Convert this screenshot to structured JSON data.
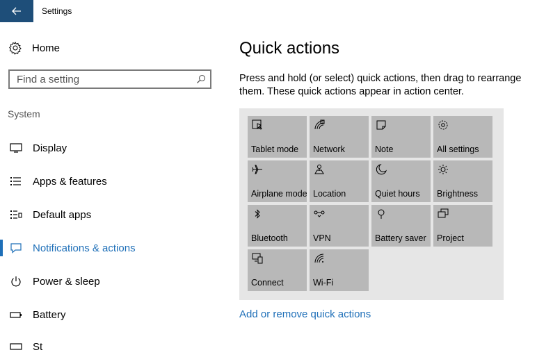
{
  "window": {
    "title": "Settings"
  },
  "sidebar": {
    "home_label": "Home",
    "search_placeholder": "Find a setting",
    "section_label": "System",
    "items": [
      {
        "label": "Display",
        "icon": "display-icon",
        "active": false
      },
      {
        "label": "Apps & features",
        "icon": "list-icon",
        "active": false
      },
      {
        "label": "Default apps",
        "icon": "default-apps-icon",
        "active": false
      },
      {
        "label": "Notifications & actions",
        "icon": "notification-icon",
        "active": true
      },
      {
        "label": "Power & sleep",
        "icon": "power-icon",
        "active": false
      },
      {
        "label": "Battery",
        "icon": "battery-icon",
        "active": false
      },
      {
        "label": "St",
        "icon": "storage-icon",
        "active": false
      }
    ]
  },
  "main": {
    "title": "Quick actions",
    "description": "Press and hold (or select) quick actions, then drag to rearrange them. These quick actions appear in action center.",
    "tiles": [
      {
        "label": "Tablet mode",
        "icon": "tablet-mode-icon"
      },
      {
        "label": "Network",
        "icon": "network-icon"
      },
      {
        "label": "Note",
        "icon": "note-icon"
      },
      {
        "label": "All settings",
        "icon": "gear-icon"
      },
      {
        "label": "Airplane mode",
        "icon": "airplane-icon"
      },
      {
        "label": "Location",
        "icon": "location-icon"
      },
      {
        "label": "Quiet hours",
        "icon": "moon-icon"
      },
      {
        "label": "Brightness",
        "icon": "sun-icon"
      },
      {
        "label": "Bluetooth",
        "icon": "bluetooth-icon"
      },
      {
        "label": "VPN",
        "icon": "vpn-icon"
      },
      {
        "label": "Battery saver",
        "icon": "battery-saver-icon"
      },
      {
        "label": "Project",
        "icon": "project-icon"
      },
      {
        "label": "Connect",
        "icon": "connect-icon"
      },
      {
        "label": "Wi-Fi",
        "icon": "wifi-icon"
      }
    ],
    "link_label": "Add or remove quick actions"
  },
  "colors": {
    "accent": "#1e6fb8",
    "titlebar_back": "#1e4e79",
    "tile": "#b8b8b8",
    "panel": "#e6e6e6"
  }
}
